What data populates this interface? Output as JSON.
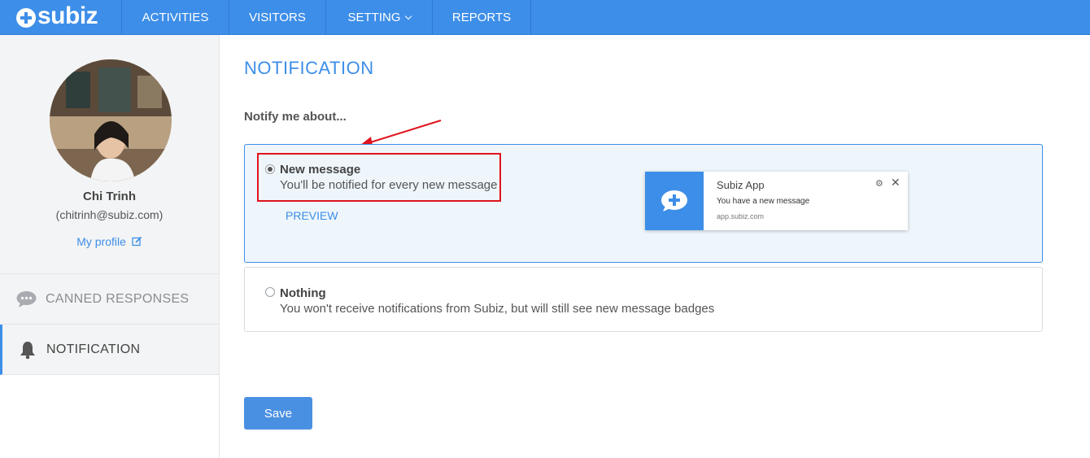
{
  "brand": {
    "logo_text": "subiz"
  },
  "nav": [
    {
      "label": "ACTIVITIES"
    },
    {
      "label": "VISITORS"
    },
    {
      "label": "SETTING"
    },
    {
      "label": "REPORTS"
    }
  ],
  "profile": {
    "name": "Chi Trinh",
    "email": "(chitrinh@subiz.com)",
    "link": "My profile"
  },
  "sidebar": {
    "items": [
      {
        "label": "CANNED RESPONSES",
        "icon": "chat-bubble-icon",
        "active": false
      },
      {
        "label": "NOTIFICATION",
        "icon": "bell-icon",
        "active": true
      }
    ]
  },
  "main": {
    "title": "NOTIFICATION",
    "subtitle": "Notify me about...",
    "options": [
      {
        "title": "New message",
        "description": "You'll be notified for every new message",
        "selected": true,
        "preview_label": "PREVIEW"
      },
      {
        "title": "Nothing",
        "description": "You won't receive notifications from Subiz, but will still see new message badges",
        "selected": false
      }
    ],
    "notification_preview": {
      "app_name": "Subiz App",
      "message": "You have a new message",
      "url": "app.subiz.com"
    },
    "save_label": "Save"
  },
  "colors": {
    "accent": "#3d8ee8",
    "highlight": "#e0141e"
  }
}
